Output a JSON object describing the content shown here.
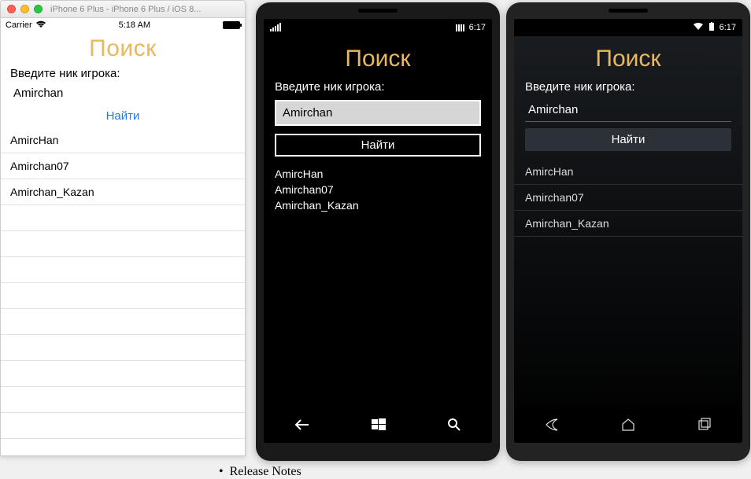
{
  "ios": {
    "window_title": "iPhone 6 Plus - iPhone 6 Plus / iOS 8...",
    "carrier": "Carrier",
    "time": "5:18 AM",
    "title": "Поиск",
    "label": "Введите ник игрока:",
    "input_value": "Amirchan",
    "find_button": "Найти",
    "results": [
      "AmircHan",
      "Amirchan07",
      "Amirchan_Kazan"
    ]
  },
  "wp": {
    "time": "6:17",
    "title": "Поиск",
    "label": "Введите ник игрока:",
    "input_value": "Amirchan",
    "find_button": "Найти",
    "results": [
      "AmircHan",
      "Amirchan07",
      "Amirchan_Kazan"
    ]
  },
  "android": {
    "time": "6:17",
    "title": "Поиск",
    "label": "Введите ник игрока:",
    "input_value": "Amirchan",
    "find_button": "Найти",
    "results": [
      "AmircHan",
      "Amirchan07",
      "Amirchan_Kazan"
    ]
  },
  "background": {
    "release_notes": "Release Notes"
  },
  "colors": {
    "accent_gold": "#e8b85e",
    "ios_link": "#147efb"
  }
}
